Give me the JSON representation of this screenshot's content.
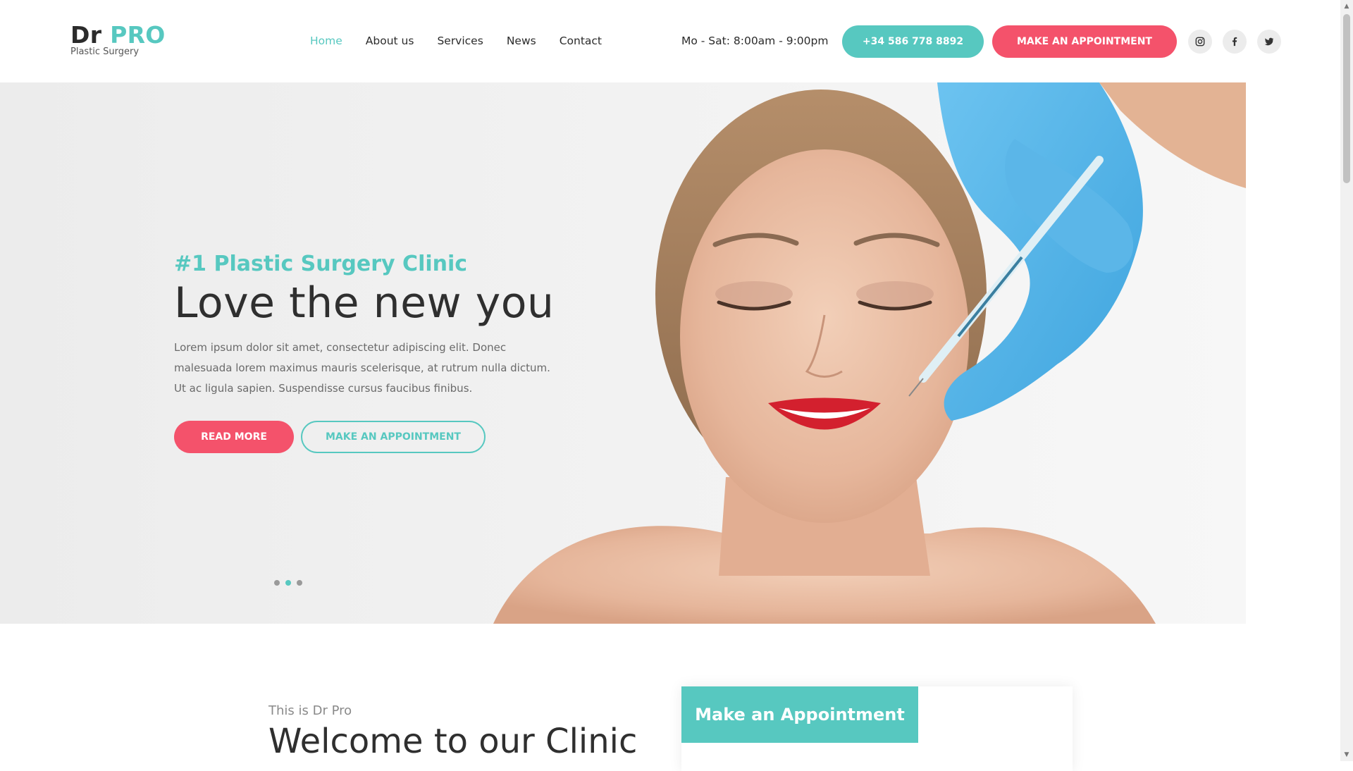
{
  "header": {
    "logo_dr": "Dr",
    "logo_pro": "PRO",
    "logo_sub": "Plastic Surgery",
    "nav": [
      {
        "label": "Home",
        "active": true
      },
      {
        "label": "About us",
        "active": false
      },
      {
        "label": "Services",
        "active": false
      },
      {
        "label": "News",
        "active": false
      },
      {
        "label": "Contact",
        "active": false
      }
    ],
    "hours": "Mo - Sat: 8:00am - 9:00pm",
    "phone_button": "+34 586 778 8892",
    "appointment_button": "MAKE AN APPOINTMENT",
    "social": [
      {
        "icon": "instagram-icon"
      },
      {
        "icon": "facebook-icon"
      },
      {
        "icon": "twitter-icon"
      }
    ]
  },
  "hero": {
    "kicker": "#1 Plastic Surgery Clinic",
    "title": "Love the new you",
    "description": "Lorem ipsum dolor sit amet, consectetur adipiscing elit. Donec malesuada lorem maximus mauris scelerisque, at rutrum nulla dictum. Ut ac ligula sapien. Suspendisse cursus faucibus finibus.",
    "read_more_button": "READ MORE",
    "appointment_button": "MAKE AN APPOINTMENT",
    "slides": 3,
    "active_slide": 2
  },
  "welcome": {
    "subtitle": "This is Dr Pro",
    "title": "Welcome to our Clinic"
  },
  "appointment_card": {
    "title": "Make an Appointment"
  },
  "colors": {
    "accent": "#57c8c0",
    "cta": "#f4526b",
    "text": "#2f2f2f"
  }
}
